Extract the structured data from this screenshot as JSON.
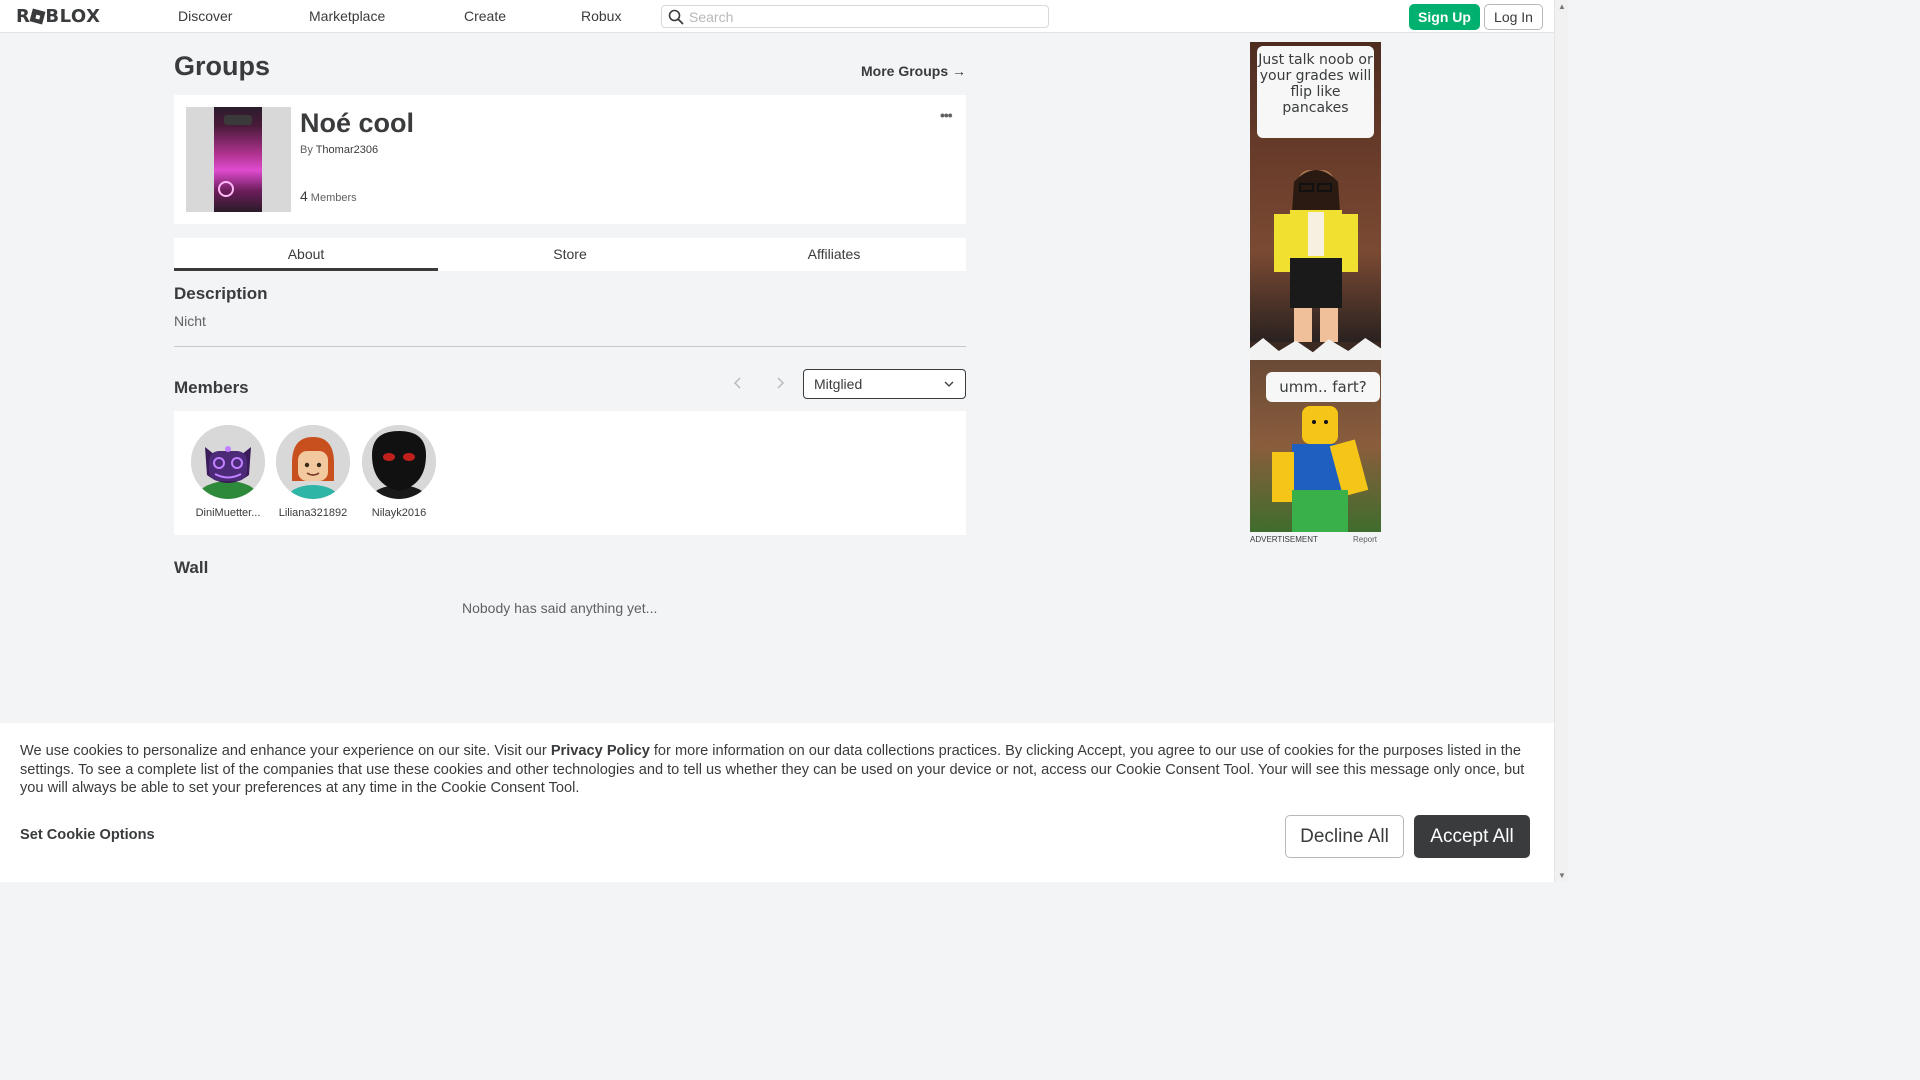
{
  "header": {
    "logo": "ROBLOX",
    "nav": [
      "Discover",
      "Marketplace",
      "Create",
      "Robux"
    ],
    "search_placeholder": "Search",
    "signup_label": "Sign Up",
    "login_label": "Log In"
  },
  "page": {
    "title": "Groups",
    "more_groups": "More Groups →"
  },
  "group": {
    "name": "Noé cool",
    "by_label": "By",
    "owner": "Thomar2306",
    "member_count": "4",
    "members_label": "Members"
  },
  "tabs": [
    "About",
    "Store",
    "Affiliates"
  ],
  "about": {
    "description_heading": "Description",
    "description": "Nicht",
    "members_heading": "Members",
    "role_selected": "Mitglied",
    "members": [
      {
        "name": "DiniMuetter..."
      },
      {
        "name": "Liliana321892"
      },
      {
        "name": "Nilayk2016"
      }
    ],
    "wall_heading": "Wall",
    "wall_empty": "Nobody has said anything yet..."
  },
  "ad": {
    "bubble_top": "Just talk noob or your grades will flip like pancakes",
    "bubble_bottom": "umm.. fart?",
    "label": "ADVERTISEMENT",
    "report": "Report"
  },
  "cookie": {
    "text_before": "We use cookies to personalize and enhance your experience on our site. Visit our ",
    "link": "Privacy Policy",
    "text_after": " for more information on our data collections practices. By clicking Accept, you agree to our use of cookies for the purposes listed in the settings. To see a complete list of the companies that use these cookies and other technologies and to tell us whether they can be used on your device or not, access our Cookie Consent Tool. Your will see this message only once, but you will always be able to set your preferences at any time in the Cookie Consent Tool.",
    "set_options": "Set Cookie Options",
    "decline": "Decline All",
    "accept": "Accept All"
  },
  "colors": {
    "brand_green": "#00b06f",
    "text_dark": "#393b3d",
    "background": "#f2f4f5"
  }
}
